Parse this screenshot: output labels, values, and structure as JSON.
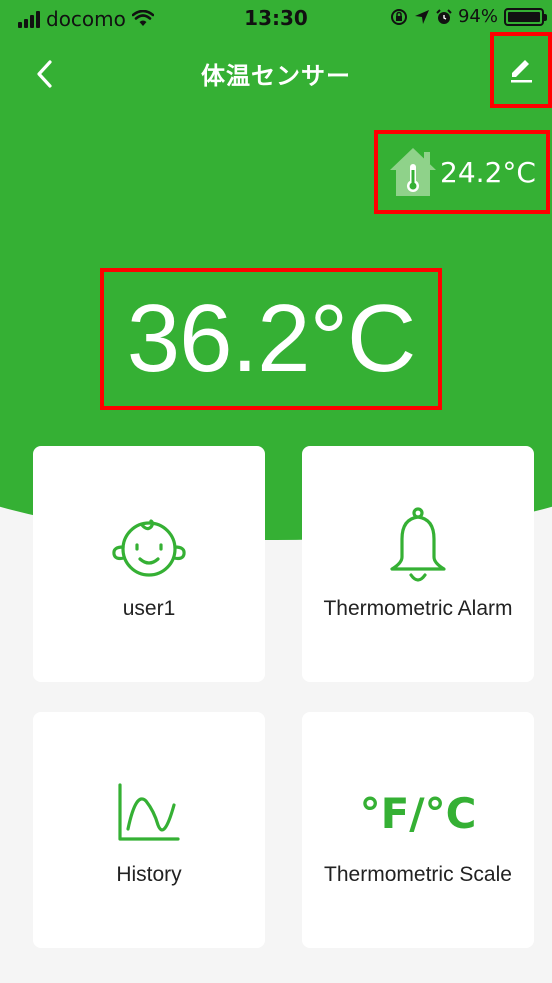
{
  "status_bar": {
    "carrier": "docomo",
    "time": "13:30",
    "battery": "94%"
  },
  "nav": {
    "title": "体温センサー"
  },
  "ambient": {
    "temperature": "24.2°C",
    "icon": "house-thermometer-icon"
  },
  "reading": {
    "temperature": "36.2°C"
  },
  "cards": [
    {
      "label": "user1",
      "icon": "baby-face-icon"
    },
    {
      "label": "Thermometric Alarm",
      "icon": "bell-icon"
    },
    {
      "label": "History",
      "icon": "history-chart-icon"
    },
    {
      "label": "Thermometric Scale",
      "icon_text": "°F/°C"
    }
  ],
  "colors": {
    "brand_green": "#35b034",
    "highlight_red": "#ff0000",
    "card_bg": "#ffffff",
    "page_bg": "#f5f5f5"
  }
}
